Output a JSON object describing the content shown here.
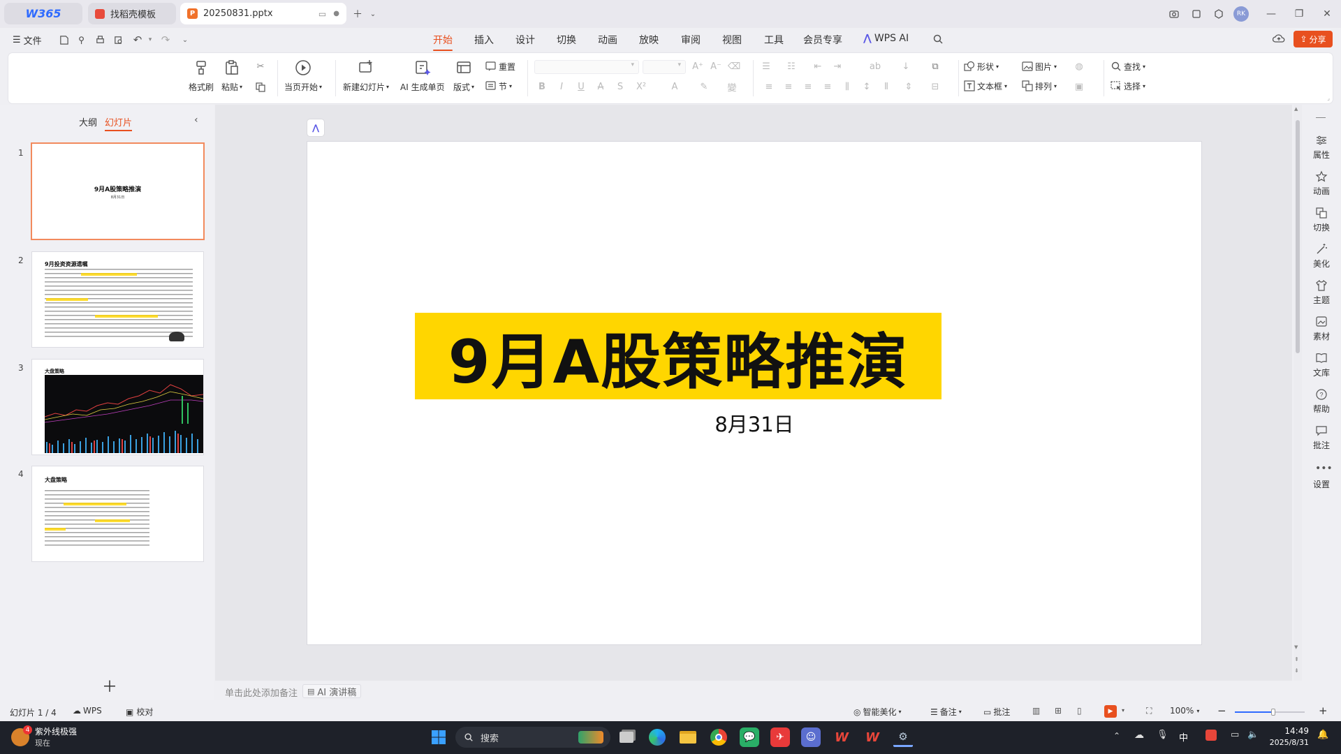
{
  "titlebar": {
    "brand": "W365",
    "tabs": [
      {
        "label": "找稻壳模板"
      },
      {
        "label": "20250831.pptx"
      }
    ],
    "user_initials": "RK"
  },
  "menubar": {
    "file": "文件",
    "tabs": [
      "开始",
      "插入",
      "设计",
      "切换",
      "动画",
      "放映",
      "审阅",
      "视图",
      "工具",
      "会员专享",
      "WPS AI"
    ],
    "share": "分享"
  },
  "ribbon": {
    "format_painter": "格式刷",
    "paste": "粘贴",
    "from_current": "当页开始",
    "new_slide": "新建幻灯片",
    "ai_single_page": "AI 生成单页",
    "layout": "版式",
    "reset": "重置",
    "section": "节",
    "shape": "形状",
    "picture": "图片",
    "textbox": "文本框",
    "arrange": "排列",
    "find": "查找",
    "select": "选择"
  },
  "leftpanel": {
    "outline_tab": "大纲",
    "slides_tab": "幻灯片",
    "thumbnails": [
      {
        "num": "1",
        "title": "9月A股策略推演",
        "sub": "8月31日"
      },
      {
        "num": "2",
        "title": "9月投资资源遗嘱"
      },
      {
        "num": "3",
        "title": "大盘策略"
      },
      {
        "num": "4",
        "title": "大盘策略"
      }
    ]
  },
  "slide": {
    "title": "9月A股策略推演",
    "subtitle": "8月31日",
    "title_bg": "#ffd600"
  },
  "rightbar": {
    "items": [
      "属性",
      "动画",
      "切换",
      "美化",
      "主题",
      "素材",
      "文库",
      "帮助",
      "批注",
      "设置"
    ]
  },
  "notes": {
    "placeholder": "单击此处添加备注",
    "ai_script": "AI 演讲稿"
  },
  "statusbar": {
    "slide_counter": "幻灯片 1 / 4",
    "wps": "WPS",
    "proofread": "校对",
    "smart_beautify": "智能美化",
    "notes": "备注",
    "comments": "批注",
    "zoom": "100%"
  },
  "taskbar": {
    "notif_title": "紫外线极强",
    "notif_sub": "现在",
    "notif_badge": "4",
    "search": "搜索",
    "ime": "中",
    "time": "14:49",
    "date": "2025/8/31"
  },
  "colors": {
    "accent": "#e8501f",
    "slide_title_bg": "#ffd600",
    "taskbar": "#1e2129"
  }
}
